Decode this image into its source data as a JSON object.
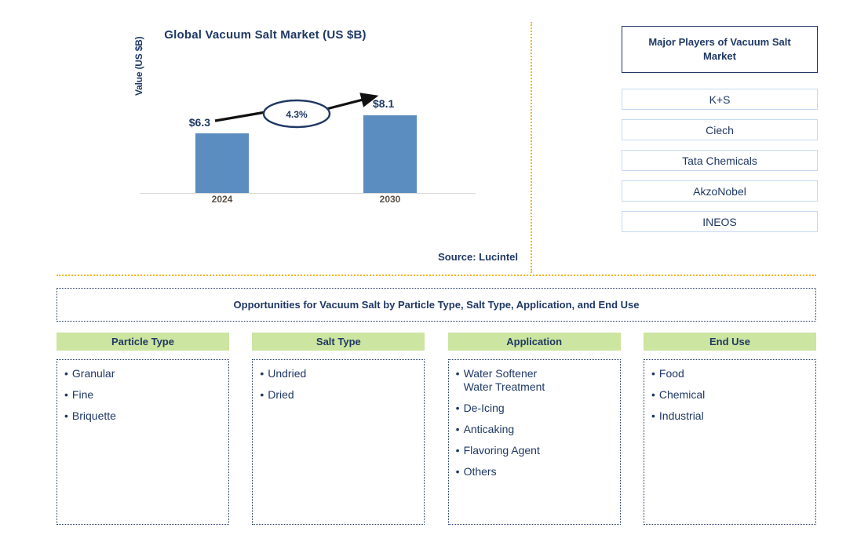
{
  "chart_data": {
    "type": "bar",
    "title": "Global Vacuum Salt Market (US $B)",
    "xlabel": "",
    "ylabel": "Value (US $B)",
    "categories": [
      "2024",
      "2030"
    ],
    "values": [
      6.3,
      8.1
    ],
    "value_labels": [
      "$6.3",
      "$8.1"
    ],
    "ylim": [
      0,
      9.5
    ],
    "grid": false,
    "legend": "none",
    "annotations": [
      {
        "text": "4.3%",
        "kind": "cagr-callout",
        "shape": "ellipse-with-arrow",
        "from": "2024",
        "to": "2030"
      }
    ],
    "series_color": "#5B8DC0",
    "source": "Source: Lucintel"
  },
  "chart": {
    "title": "Global Vacuum Salt Market (US $B)",
    "y_axis_label": "Value (US $B)",
    "tick_labels": [
      "2024",
      "2030"
    ],
    "bar_labels": [
      "$6.3",
      "$8.1"
    ],
    "cagr": "4.3%",
    "source": "Source: Lucintel"
  },
  "players": {
    "header": "Major Players of Vacuum Salt Market",
    "items": [
      {
        "label": "K+S"
      },
      {
        "label": "Ciech"
      },
      {
        "label": "Tata Chemicals"
      },
      {
        "label": "AkzoNobel"
      },
      {
        "label": "INEOS"
      }
    ]
  },
  "opportunities": {
    "banner": "Opportunities for Vacuum Salt by Particle Type, Salt Type, Application, and End Use",
    "bullet": "•",
    "columns": [
      {
        "header": "Particle Type",
        "items": [
          {
            "text": "Granular"
          },
          {
            "text": "Fine"
          },
          {
            "text": "Briquette"
          }
        ]
      },
      {
        "header": "Salt Type",
        "items": [
          {
            "text": "Undried"
          },
          {
            "text": "Dried"
          }
        ]
      },
      {
        "header": "Application",
        "items": [
          {
            "text": "Water Softener",
            "subline": "Water Treatment"
          },
          {
            "text": "De-Icing"
          },
          {
            "text": "Anticaking"
          },
          {
            "text": "Flavoring Agent"
          },
          {
            "text": "Others"
          }
        ]
      },
      {
        "header": "End Use",
        "items": [
          {
            "text": "Food"
          },
          {
            "text": "Chemical"
          },
          {
            "text": "Industrial"
          }
        ]
      }
    ]
  },
  "colors": {
    "bar": "#5B8DC0",
    "navy": "#1F3864",
    "header_green": "#CCE5A0",
    "divider_amber": "#FBB317",
    "player_border": "#C5D9F1"
  }
}
